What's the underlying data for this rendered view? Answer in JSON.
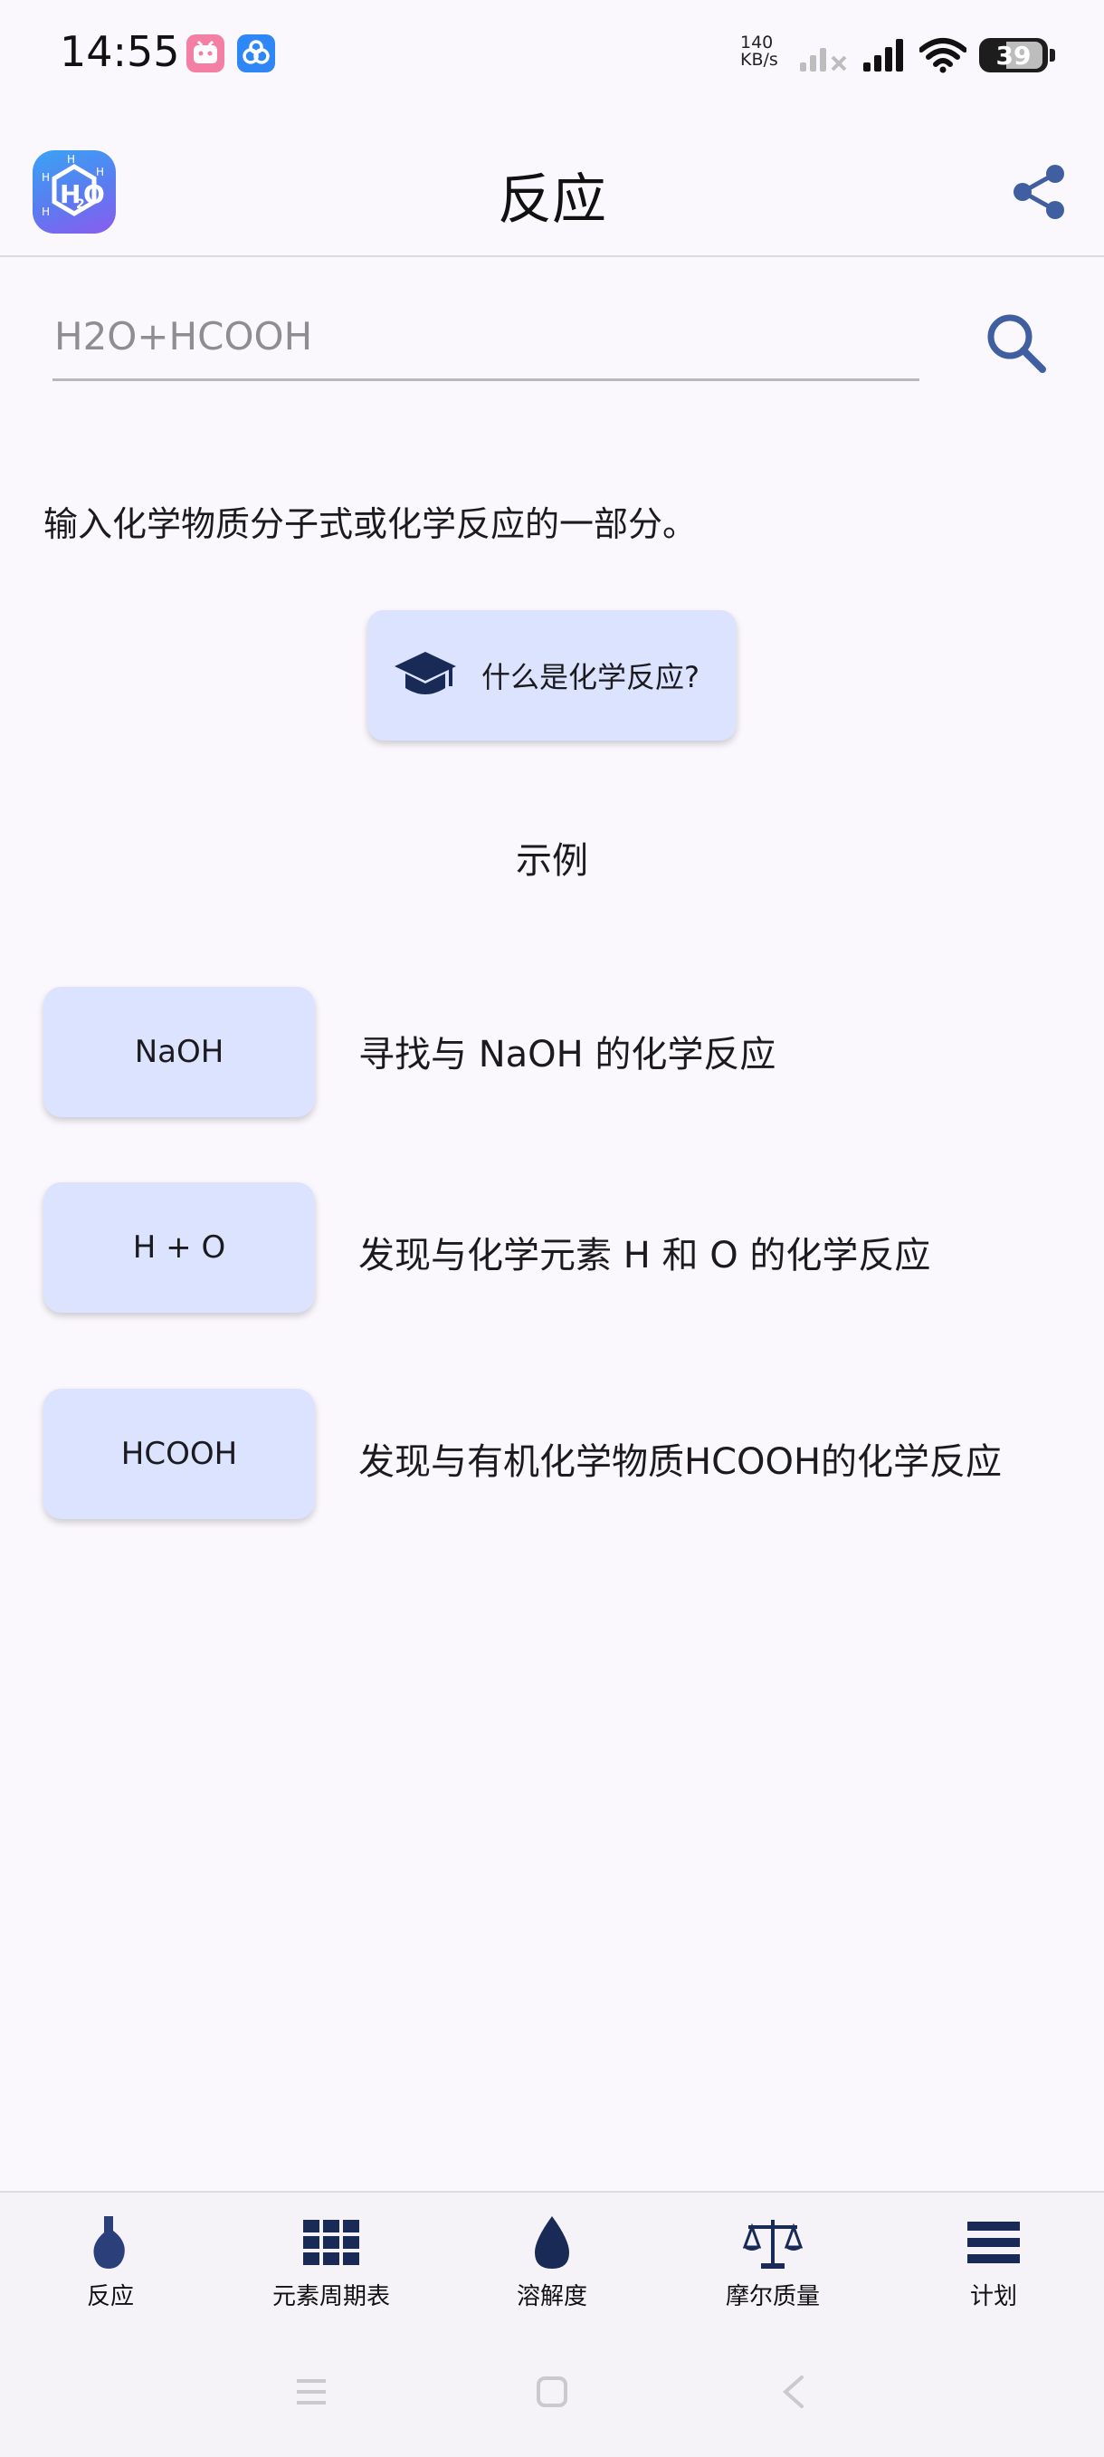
{
  "status_bar": {
    "time": "14:55",
    "net_speed_value": "140",
    "net_speed_unit": "KB/s",
    "battery": "39",
    "notification_icons": [
      "bilibili-icon",
      "baidu-netdisk-icon"
    ]
  },
  "app_bar": {
    "title": "反应",
    "logo": "h2o-app-logo",
    "share_icon": "share-icon"
  },
  "search": {
    "placeholder": "H2O+HCOOH",
    "value": "",
    "icon": "search-icon"
  },
  "hint": "输入化学物质分子式或化学反应的一部分。",
  "what_button": {
    "label": "什么是化学反应?",
    "icon": "graduation-cap-icon"
  },
  "examples": {
    "title": "示例",
    "items": [
      {
        "chip": "NaOH",
        "description": "寻找与 NaOH 的化学反应"
      },
      {
        "chip": "H + O",
        "description": "发现与化学元素 H 和 O 的化学反应"
      },
      {
        "chip": "HCOOH",
        "description": "发现与有机化学物质HCOOH的化学反应"
      }
    ]
  },
  "bottom_nav": {
    "items": [
      {
        "label": "反应",
        "icon": "flask-icon",
        "active": true
      },
      {
        "label": "元素周期表",
        "icon": "periodic-table-icon",
        "active": false
      },
      {
        "label": "溶解度",
        "icon": "drop-icon",
        "active": false
      },
      {
        "label": "摩尔质量",
        "icon": "scale-icon",
        "active": false
      },
      {
        "label": "计划",
        "icon": "menu-icon",
        "active": false
      }
    ]
  },
  "colors": {
    "background": "#FBF8FD",
    "chip_background": "#DCE3FF",
    "icon_navy": "#1A2A57",
    "accent": "#3F5FA0"
  }
}
